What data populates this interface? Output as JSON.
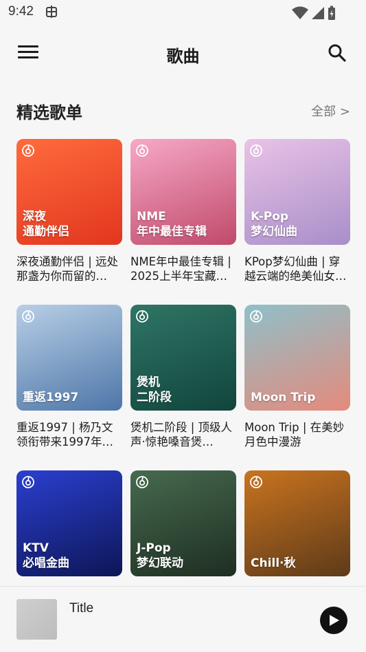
{
  "status_bar": {
    "time": "9:42",
    "carrier_icon": "android-debug-icon"
  },
  "app_bar": {
    "title": "歌曲"
  },
  "section": {
    "title": "精选歌单",
    "see_all": "全部 >"
  },
  "playlists": [
    {
      "cover_lines": [
        "深夜",
        "通勤伴侣"
      ],
      "desc": "深夜通勤伴侣 | 远处那盏为你而留的…",
      "colors": [
        "#ff6b3d",
        "#e2361f"
      ]
    },
    {
      "cover_lines": [
        "NME",
        "年中最佳专辑"
      ],
      "desc": "NME年中最佳专辑 | 2025上半年宝藏…",
      "colors": [
        "#f7a8c8",
        "#c04a6a"
      ]
    },
    {
      "cover_lines": [
        "K-Pop",
        "梦幻仙曲"
      ],
      "desc": "KPop梦幻仙曲 | 穿越云端的绝美仙女…",
      "colors": [
        "#e9c3e6",
        "#a88ec9"
      ]
    },
    {
      "cover_lines": [
        "重返1997"
      ],
      "desc": "重返1997 | 杨乃文领衔带来1997年…",
      "colors": [
        "#b8cfe6",
        "#4d76a8"
      ]
    },
    {
      "cover_lines": [
        "煲机",
        "二阶段"
      ],
      "desc": "煲机二阶段 | 顶级人声·惊艳嗓音煲…",
      "colors": [
        "#2f7566",
        "#11453c"
      ]
    },
    {
      "cover_lines": [
        "Moon Trip"
      ],
      "desc": "Moon Trip | 在美妙月色中漫游",
      "colors": [
        "#8fc0c9",
        "#e58a7c"
      ]
    },
    {
      "cover_lines": [
        "KTV",
        "必唱金曲"
      ],
      "desc": "",
      "colors": [
        "#2b3fd0",
        "#0d1656"
      ]
    },
    {
      "cover_lines": [
        "J-Pop",
        "梦幻联动"
      ],
      "desc": "",
      "colors": [
        "#466a4f",
        "#1e2e22"
      ]
    },
    {
      "cover_lines": [
        "Chill·秋"
      ],
      "desc": "",
      "colors": [
        "#c9741f",
        "#5e3a19"
      ]
    }
  ],
  "mini_player": {
    "title": "Title"
  }
}
